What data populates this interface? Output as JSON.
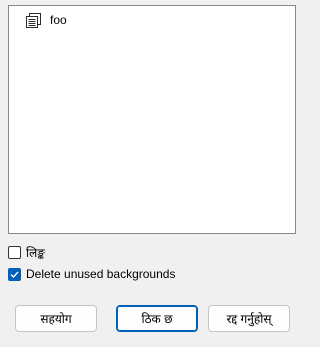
{
  "list": {
    "items": [
      {
        "label": "foo",
        "icon": "document-list-icon"
      }
    ]
  },
  "options": {
    "first": {
      "label": "लिङ्क",
      "checked": false
    },
    "second": {
      "label": "Delete unused backgrounds",
      "checked": true
    }
  },
  "buttons": {
    "help": "सहयोग",
    "ok": "ठिक छ",
    "cancel": "रद्द गर्नुहोस्"
  },
  "colors": {
    "accent": "#005fb8",
    "background": "#f0f0f0",
    "list_border": "#828790"
  }
}
